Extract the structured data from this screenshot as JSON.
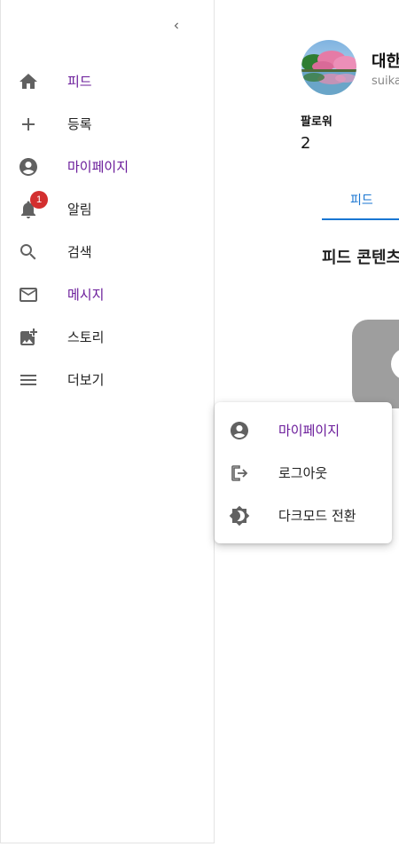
{
  "sidebar": {
    "collapse_icon": "chevron-left-icon",
    "items": [
      {
        "label": "피드",
        "icon": "home-icon",
        "active": true
      },
      {
        "label": "등록",
        "icon": "plus-icon",
        "active": false
      },
      {
        "label": "마이페이지",
        "icon": "account-circle-icon",
        "active": true
      },
      {
        "label": "알림",
        "icon": "bell-icon",
        "active": false
      },
      {
        "label": "검색",
        "icon": "search-icon",
        "active": false
      },
      {
        "label": "메시지",
        "icon": "mail-icon",
        "active": true
      },
      {
        "label": "스토리",
        "icon": "add-photo-icon",
        "active": false
      },
      {
        "label": "더보기",
        "icon": "menu-icon",
        "active": false
      }
    ],
    "notification_badge": "1"
  },
  "profile": {
    "name": "대한",
    "user_id": "suika",
    "follower_label": "팔로워",
    "follower_count": "2"
  },
  "tabs": [
    {
      "label": "피드",
      "selected": true
    }
  ],
  "content": {
    "title": "피드 콘텐츠"
  },
  "more_menu": {
    "items": [
      {
        "label": "마이페이지",
        "icon": "account-circle-icon",
        "active": true
      },
      {
        "label": "로그아웃",
        "icon": "logout-icon",
        "active": false
      },
      {
        "label": "다크모드 전환",
        "icon": "brightness-icon",
        "active": false
      }
    ]
  },
  "colors": {
    "active_text": "#6a1b9a",
    "tab_accent": "#1976d2",
    "badge": "#d32f2f",
    "icon": "#616161"
  }
}
